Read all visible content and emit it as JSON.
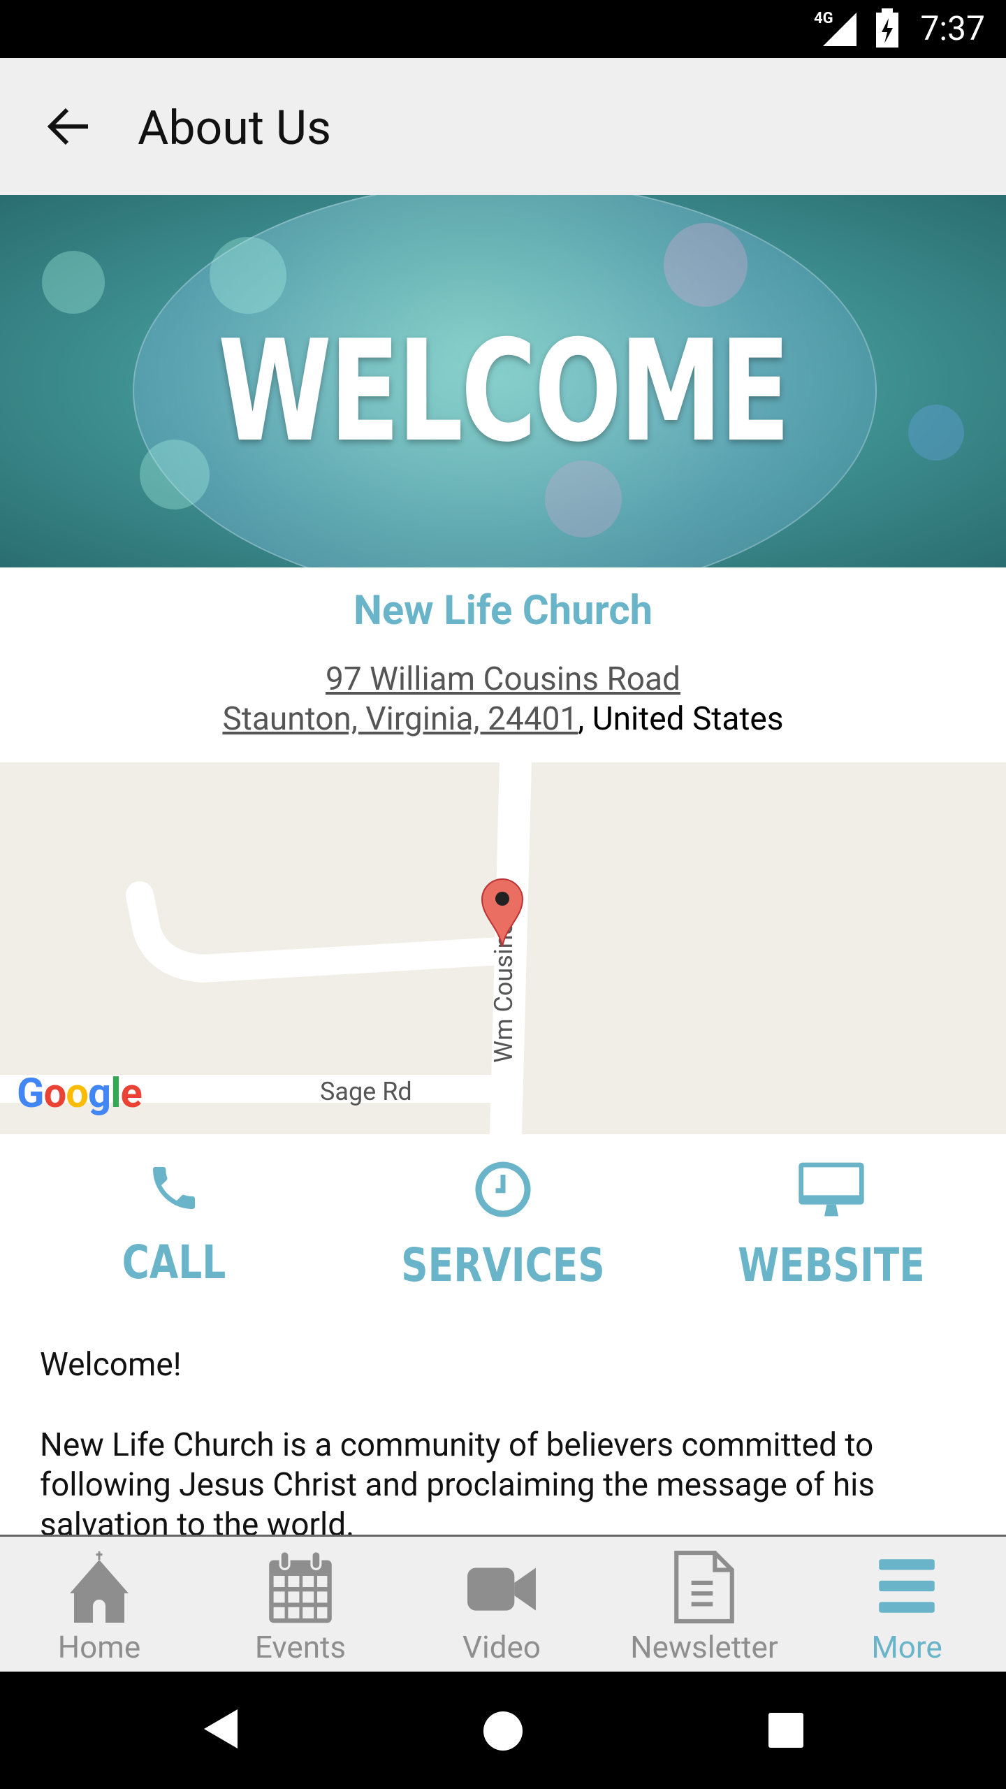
{
  "status": {
    "network": "4G",
    "time": "7:37"
  },
  "appbar": {
    "title": "About Us"
  },
  "banner": {
    "text": "WELCOME"
  },
  "church": {
    "name": "New Life Church",
    "address_line1": "97 William Cousins Road",
    "address_line2": "Staunton, Virginia, 24401",
    "country": ", United States"
  },
  "map": {
    "road1": "Wm Cousins",
    "road2": "Sage Rd",
    "logo": "Google"
  },
  "actions": [
    {
      "label": "CALL",
      "icon": "phone-icon"
    },
    {
      "label": "SERVICES",
      "icon": "clock-icon"
    },
    {
      "label": "WEBSITE",
      "icon": "monitor-icon"
    }
  ],
  "content": {
    "greeting": "Welcome!",
    "line1": "New Life Church is a community of believers committed to",
    "line2": "following Jesus Christ and proclaiming the message of his",
    "line3": "salvation to the world."
  },
  "nav": [
    {
      "label": "Home",
      "icon": "church-icon"
    },
    {
      "label": "Events",
      "icon": "calendar-icon"
    },
    {
      "label": "Video",
      "icon": "video-camera-icon"
    },
    {
      "label": "Newsletter",
      "icon": "document-icon"
    },
    {
      "label": "More",
      "icon": "menu-icon",
      "active": true
    }
  ],
  "colors": {
    "accent": "#6ab4c9",
    "inactive": "#8e8e8e"
  }
}
